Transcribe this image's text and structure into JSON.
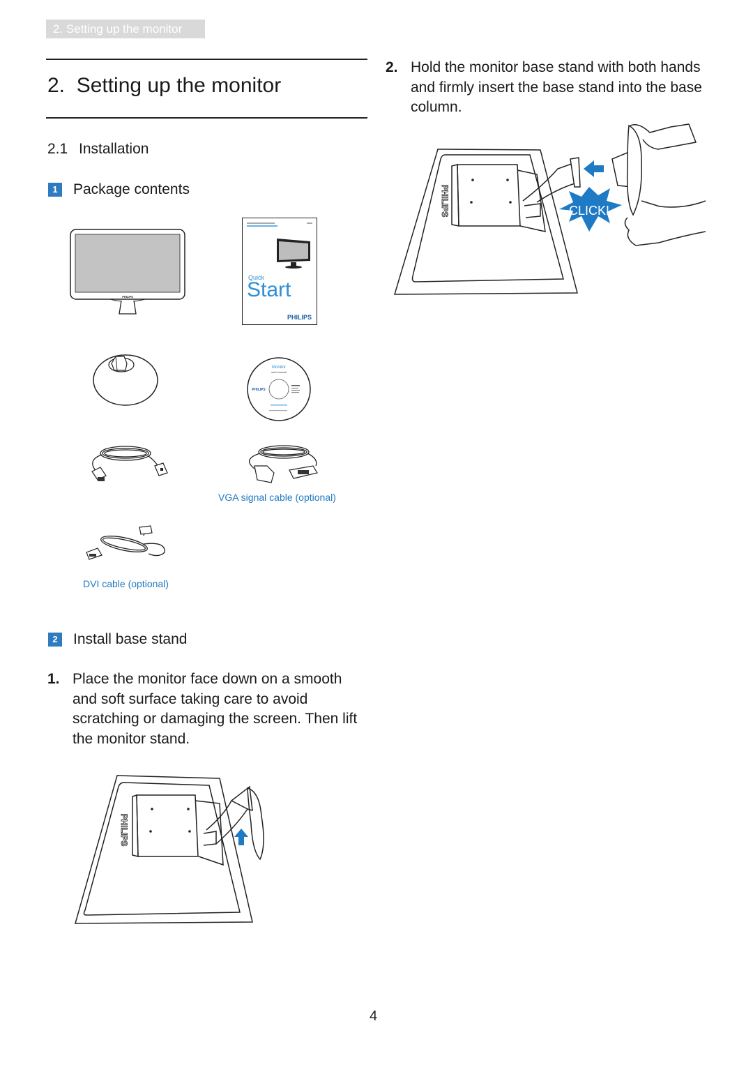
{
  "header": {
    "breadcrumb": "2. Setting up the monitor"
  },
  "section": {
    "title": "2.  Setting up the monitor",
    "subsection_number": "2.1",
    "subsection_title": "Installation"
  },
  "steps": [
    {
      "badge": "1",
      "label": "Package contents"
    },
    {
      "badge": "2",
      "label": "Install base stand"
    }
  ],
  "package_items": [
    {
      "name": "monitor",
      "caption": ""
    },
    {
      "name": "quick-start-guide",
      "caption": "",
      "brand": "PHILIPS",
      "title_small": "Quick",
      "title_large": "Start"
    },
    {
      "name": "base-stand",
      "caption": ""
    },
    {
      "name": "cd-rom",
      "caption": "",
      "brand": "PHILIPS",
      "title": "Monitor",
      "subtitle": "user's manual"
    },
    {
      "name": "power-cord",
      "caption": ""
    },
    {
      "name": "vga-cable",
      "caption": "VGA signal cable (optional)"
    },
    {
      "name": "dvi-cable",
      "caption": "DVI cable (optional)"
    }
  ],
  "instructions": [
    {
      "number": "1.",
      "text": "Place the monitor face down on a smooth and soft surface taking care to avoid scratching or damaging the screen. Then lift the monitor stand."
    },
    {
      "number": "2.",
      "text": "Hold the monitor base stand with both hands and firmly insert the base stand into the base column."
    }
  ],
  "illustrations": {
    "monitor_brand": "PHILIPS",
    "click_label": "CLICK!"
  },
  "colors": {
    "accent": "#2f7bbf",
    "caption": "#1f78c1",
    "click_burst": "#1e7ac4"
  },
  "footer": {
    "page_number": "4"
  }
}
